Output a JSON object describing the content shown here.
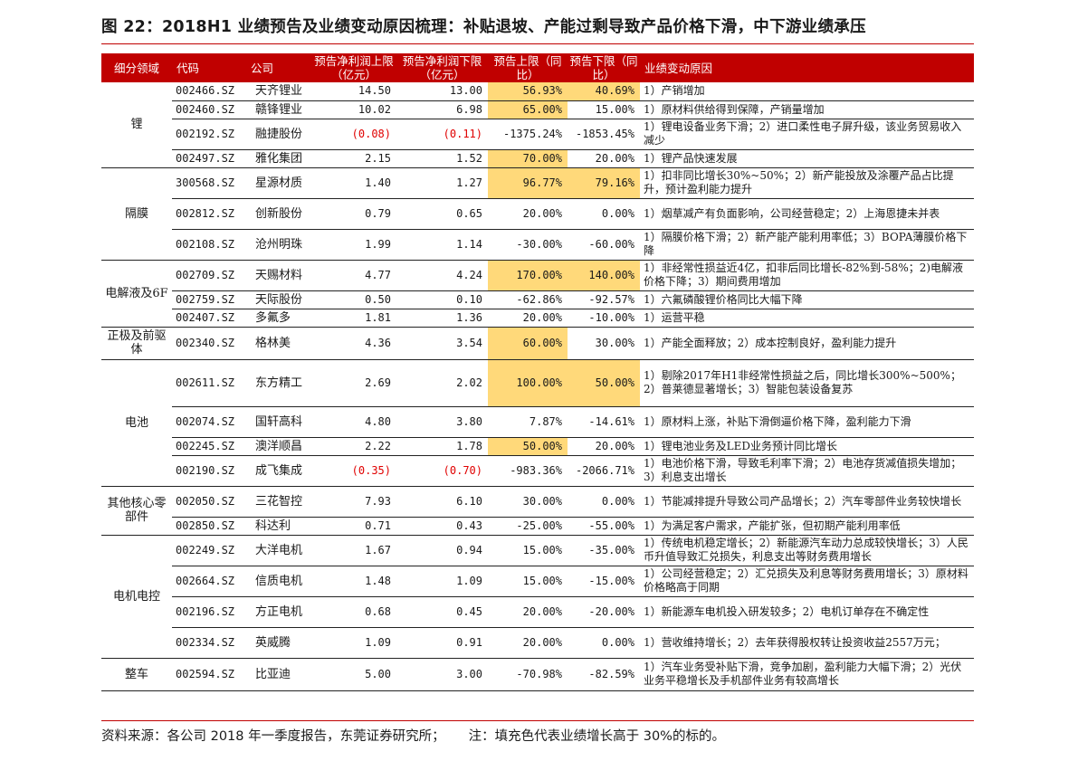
{
  "title": "图 22：2018H1 业绩预告及业绩变动原因梳理：补贴退坡、产能过剩导致产品价格下滑，中下游业绩承压",
  "headers": [
    "细分领域",
    "代码",
    "公司",
    "预告净利润上限（亿元）",
    "预告净利润下限（亿元）",
    "预告上限（同比）",
    "预告下限（同比）",
    "业绩变动原因"
  ],
  "highlight_color": "#ffd97a",
  "negative_color": "#e00000",
  "header_color": "#c00000",
  "groups": [
    {
      "name": "锂",
      "rows": [
        {
          "code": "002466.SZ",
          "name": "天齐锂业",
          "up": "14.50",
          "low": "13.00",
          "upYoY": "56.93%",
          "lowYoY": "40.69%",
          "reason": "1）产销增加",
          "hlUp": true,
          "hlLow": true
        },
        {
          "code": "002460.SZ",
          "name": "赣锋锂业",
          "up": "10.02",
          "low": "6.98",
          "upYoY": "65.00%",
          "lowYoY": "15.00%",
          "reason": "1）原材料供给得到保障，产销量增加",
          "hlUp": true
        },
        {
          "code": "002192.SZ",
          "name": "融捷股份",
          "up": "(0.08)",
          "low": "(0.11)",
          "upYoY": "-1375.24%",
          "lowYoY": "-1853.45%",
          "reason": "1）锂电设备业务下滑；2）进口柔性电子屏升级，该业务贸易收入减少",
          "negUp": true,
          "negLow": true
        },
        {
          "code": "002497.SZ",
          "name": "雅化集团",
          "up": "2.15",
          "low": "1.52",
          "upYoY": "70.00%",
          "lowYoY": "20.00%",
          "reason": "1）锂产品快速发展",
          "hlUp": true
        }
      ]
    },
    {
      "name": "隔膜",
      "rows": [
        {
          "code": "300568.SZ",
          "name": "星源材质",
          "up": "1.40",
          "low": "1.27",
          "upYoY": "96.77%",
          "lowYoY": "79.16%",
          "reason": "1）扣非同比增长30%~50%；2）新产能投放及涂覆产品占比提升，预计盈利能力提升",
          "hlUp": true,
          "hlLow": true
        },
        {
          "code": "002812.SZ",
          "name": "创新股份",
          "up": "0.79",
          "low": "0.65",
          "upYoY": "20.00%",
          "lowYoY": "0.00%",
          "reason": "1）烟草减产有负面影响，公司经营稳定；2）上海恩捷未并表"
        },
        {
          "code": "002108.SZ",
          "name": "沧州明珠",
          "up": "1.99",
          "low": "1.14",
          "upYoY": "-30.00%",
          "lowYoY": "-60.00%",
          "reason": "1）隔膜价格下滑；2）新产能产能利用率低；3）BOPA薄膜价格下降"
        }
      ]
    },
    {
      "name": "电解液及6F",
      "rows": [
        {
          "code": "002709.SZ",
          "name": "天赐材料",
          "up": "4.77",
          "low": "4.24",
          "upYoY": "170.00%",
          "lowYoY": "140.00%",
          "reason": "1）非经常性损益近4亿，扣非后同比增长-82%到-58%；2)电解液价格下降；3）期间费用增加",
          "hlUp": true,
          "hlLow": true
        },
        {
          "code": "002759.SZ",
          "name": "天际股份",
          "up": "0.50",
          "low": "0.10",
          "upYoY": "-62.86%",
          "lowYoY": "-92.57%",
          "reason": "1）六氟磷酸锂价格同比大幅下降"
        },
        {
          "code": "002407.SZ",
          "name": "多氟多",
          "up": "1.81",
          "low": "1.36",
          "upYoY": "20.00%",
          "lowYoY": "-10.00%",
          "reason": "1）运营平稳"
        }
      ]
    },
    {
      "name": "正极及前驱体",
      "rows": [
        {
          "code": "002340.SZ",
          "name": "格林美",
          "up": "4.36",
          "low": "3.54",
          "upYoY": "60.00%",
          "lowYoY": "30.00%",
          "reason": "1）产能全面释放；2）成本控制良好，盈利能力提升",
          "hlUp": true
        }
      ]
    },
    {
      "name": "电池",
      "rows": [
        {
          "code": "002611.SZ",
          "name": "东方精工",
          "up": "2.69",
          "low": "2.02",
          "upYoY": "100.00%",
          "lowYoY": "50.00%",
          "reason": "1）剔除2017年H1非经常性损益之后，同比增长300%~500%；2）普莱德显著增长；3）智能包装设备复苏",
          "hlUp": true,
          "hlLow": true
        },
        {
          "code": "002074.SZ",
          "name": "国轩高科",
          "up": "4.80",
          "low": "3.80",
          "upYoY": "7.87%",
          "lowYoY": "-14.61%",
          "reason": "1）原材料上涨，补贴下滑倒逼价格下降，盈利能力下滑"
        },
        {
          "code": "002245.SZ",
          "name": "澳洋顺昌",
          "up": "2.22",
          "low": "1.78",
          "upYoY": "50.00%",
          "lowYoY": "20.00%",
          "reason": "1）锂电池业务及LED业务预计同比增长",
          "hlUp": true
        },
        {
          "code": "002190.SZ",
          "name": "成飞集成",
          "up": "(0.35)",
          "low": "(0.70)",
          "upYoY": "-983.36%",
          "lowYoY": "-2066.71%",
          "reason": "1）电池价格下滑，导致毛利率下滑；2）电池存货减值损失增加；3）利息支出增长",
          "negUp": true,
          "negLow": true
        }
      ]
    },
    {
      "name": "其他核心零部件",
      "rows": [
        {
          "code": "002050.SZ",
          "name": "三花智控",
          "up": "7.93",
          "low": "6.10",
          "upYoY": "30.00%",
          "lowYoY": "0.00%",
          "reason": "1）节能减排提升导致公司产品增长；2）汽车零部件业务较快增长"
        },
        {
          "code": "002850.SZ",
          "name": "科达利",
          "up": "0.71",
          "low": "0.43",
          "upYoY": "-25.00%",
          "lowYoY": "-55.00%",
          "reason": "1）为满足客户需求，产能扩张，但初期产能利用率低"
        }
      ]
    },
    {
      "name": "电机电控",
      "rows": [
        {
          "code": "002249.SZ",
          "name": "大洋电机",
          "up": "1.67",
          "low": "0.94",
          "upYoY": "15.00%",
          "lowYoY": "-35.00%",
          "reason": "1）传统电机稳定增长；2）新能源汽车动力总成较快增长；3）人民币升值导致汇兑损失，利息支出等财务费用增长"
        },
        {
          "code": "002664.SZ",
          "name": "信质电机",
          "up": "1.48",
          "low": "1.09",
          "upYoY": "15.00%",
          "lowYoY": "-15.00%",
          "reason": "1）公司经营稳定；2）汇兑损失及利息等财务费用增长；3）原材料价格略高于同期"
        },
        {
          "code": "002196.SZ",
          "name": "方正电机",
          "up": "0.68",
          "low": "0.45",
          "upYoY": "20.00%",
          "lowYoY": "-20.00%",
          "reason": "1）新能源车电机投入研发较多；2）电机订单存在不确定性"
        },
        {
          "code": "002334.SZ",
          "name": "英威腾",
          "up": "1.09",
          "low": "0.91",
          "upYoY": "20.00%",
          "lowYoY": "0.00%",
          "reason": "1）营收维持增长；2）去年获得股权转让投资收益2557万元；"
        }
      ]
    },
    {
      "name": "整车",
      "rows": [
        {
          "code": "002594.SZ",
          "name": "比亚迪",
          "up": "5.00",
          "low": "3.00",
          "upYoY": "-70.98%",
          "lowYoY": "-82.59%",
          "reason": "1）汽车业务受补贴下滑，竞争加剧，盈利能力大幅下滑；2）光伏业务平稳增长及手机部件业务有较高增长"
        }
      ]
    }
  ],
  "source_text": "资料来源：各公司 2018 年一季度报告，东莞证券研究所；",
  "note_text": "注：填充色代表业绩增长高于 30%的标的。"
}
